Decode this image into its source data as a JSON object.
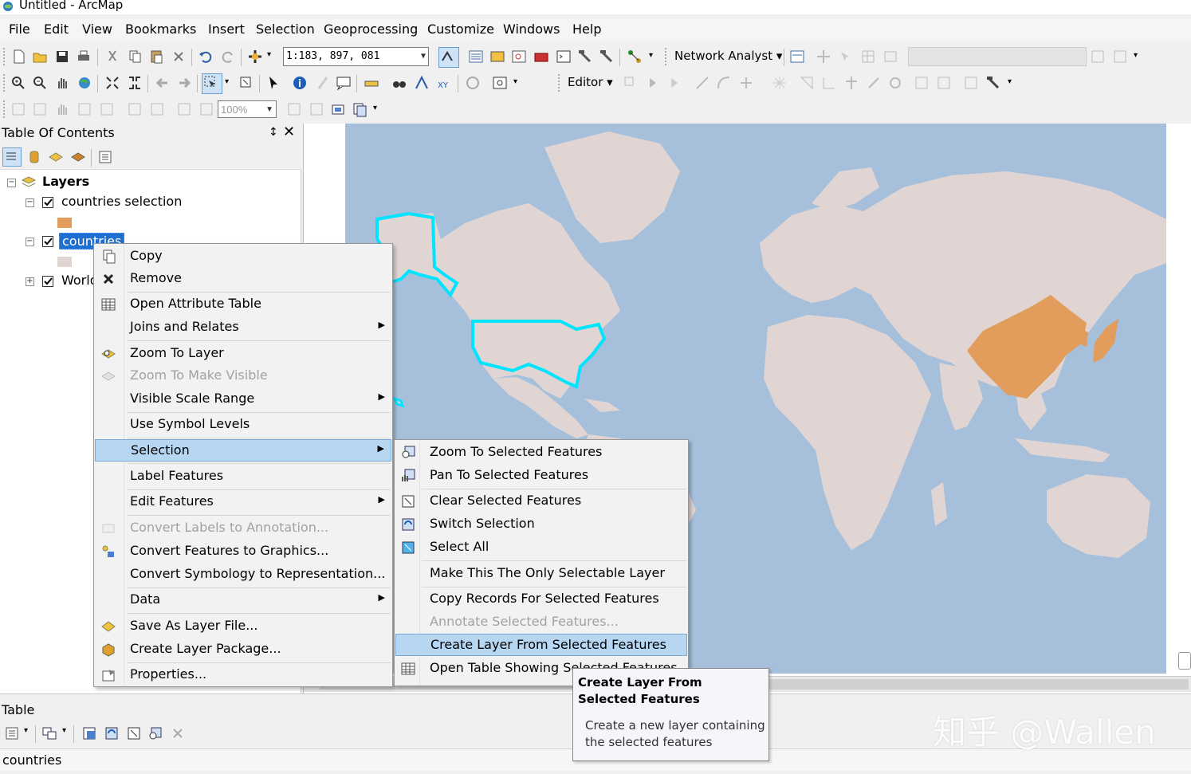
{
  "window": {
    "title": "Untitled - ArcMap"
  },
  "menubar": {
    "items": [
      "File",
      "Edit",
      "View",
      "Bookmarks",
      "Insert",
      "Selection",
      "Geoprocessing",
      "Customize",
      "Windows",
      "Help"
    ]
  },
  "toolbar": {
    "scale_value": "1:183, 897, 081",
    "network_analyst_label": "Network Analyst",
    "editor_label": "Editor",
    "zoom_percent": "100%"
  },
  "toc": {
    "title": "Table Of Contents",
    "pin_glyph": "↕",
    "close_glyph": "✕",
    "root_label": "Layers",
    "layers": [
      {
        "name": "countries selection",
        "checked": true,
        "swatch_color": "#e29c5c"
      },
      {
        "name": "countries",
        "checked": true,
        "swatch_color": "#e0d5d3",
        "selected": true
      },
      {
        "name": "World",
        "checked": true
      }
    ]
  },
  "context_menu": {
    "items": [
      {
        "label": "Copy",
        "icon": "copy-icon"
      },
      {
        "label": "Remove",
        "icon": "remove-icon"
      },
      {
        "label": "Open Attribute Table",
        "icon": "table-icon"
      },
      {
        "label": "Joins and Relates",
        "submenu": true
      },
      {
        "label": "Zoom To Layer",
        "icon": "zoom-to-layer-icon"
      },
      {
        "label": "Zoom To Make Visible",
        "icon": "zoom-visible-icon",
        "disabled": true
      },
      {
        "label": "Visible Scale Range",
        "submenu": true
      },
      {
        "label": "Use Symbol Levels"
      },
      {
        "label": "Selection",
        "submenu": true,
        "highlighted": true
      },
      {
        "label": "Label Features"
      },
      {
        "label": "Edit Features",
        "submenu": true
      },
      {
        "label": "Convert Labels to Annotation...",
        "icon": "convert-labels-icon",
        "disabled": true
      },
      {
        "label": "Convert Features to Graphics...",
        "icon": "convert-graphics-icon"
      },
      {
        "label": "Convert Symbology to Representation..."
      },
      {
        "label": "Data",
        "submenu": true
      },
      {
        "label": "Save As Layer File...",
        "icon": "layer-file-icon"
      },
      {
        "label": "Create Layer Package...",
        "icon": "layer-package-icon"
      },
      {
        "label": "Properties...",
        "icon": "properties-icon"
      }
    ]
  },
  "selection_submenu": {
    "items": [
      {
        "label": "Zoom To Selected Features",
        "icon": "zoom-selected-icon"
      },
      {
        "label": "Pan To Selected Features",
        "icon": "pan-selected-icon"
      },
      {
        "label": "Clear Selected Features",
        "icon": "clear-selection-icon"
      },
      {
        "label": "Switch Selection",
        "icon": "switch-selection-icon"
      },
      {
        "label": "Select All",
        "icon": "select-all-icon"
      },
      {
        "label": "Make This The Only Selectable Layer"
      },
      {
        "label": "Copy Records For Selected Features"
      },
      {
        "label": "Annotate Selected Features...",
        "disabled": true
      },
      {
        "label": "Create Layer From Selected Features",
        "highlighted": true
      },
      {
        "label": "Open Table Showing Selected Features",
        "icon": "table-icon"
      }
    ]
  },
  "tooltip": {
    "title": "Create Layer From Selected Features",
    "body": "Create a new layer containing the selected features"
  },
  "table_window": {
    "title": "Table",
    "tab_label": "countries"
  },
  "watermark": "知乎 @Wallen",
  "colors": {
    "ocean": "#a6c0dc",
    "land": "#e0d5d3",
    "selected_country": "#e29c5c",
    "selection_outline": "#00e5ff",
    "menu_highlight": "#b6d6f2"
  }
}
